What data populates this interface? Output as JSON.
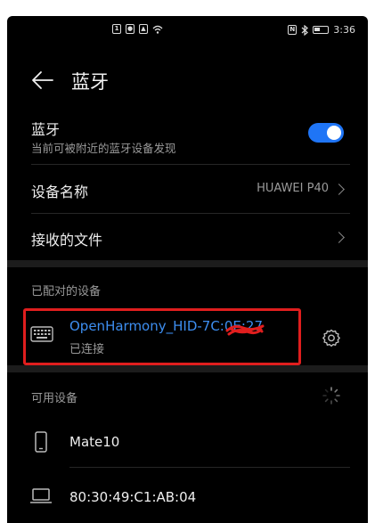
{
  "status_bar": {
    "left_icons": [
      "notification-icon-1",
      "notification-icon-2",
      "notification-icon-3",
      "wifi-icon"
    ],
    "right_icons": [
      "nfc-icon",
      "bluetooth-icon",
      "battery-icon"
    ],
    "time": "3:36"
  },
  "header": {
    "title": "蓝牙"
  },
  "bluetooth": {
    "label": "蓝牙",
    "sublabel": "当前可被附近的蓝牙设备发现",
    "enabled": true
  },
  "device_name": {
    "label": "设备名称",
    "value": "HUAWEI P40"
  },
  "received_files": {
    "label": "接收的文件"
  },
  "paired": {
    "header": "已配对的设备",
    "devices": [
      {
        "name": "OpenHarmony_HID-7C:0E:27",
        "status": "已连接",
        "icon": "keyboard-icon"
      }
    ]
  },
  "available": {
    "header": "可用设备",
    "devices": [
      {
        "name": "Mate10",
        "icon": "phone-icon"
      },
      {
        "name": "80:30:49:C1:AB:04",
        "icon": "laptop-icon"
      }
    ]
  },
  "colors": {
    "accent": "#1f75f6",
    "link": "#3d8ef0",
    "annotation": "#e01e1e"
  }
}
